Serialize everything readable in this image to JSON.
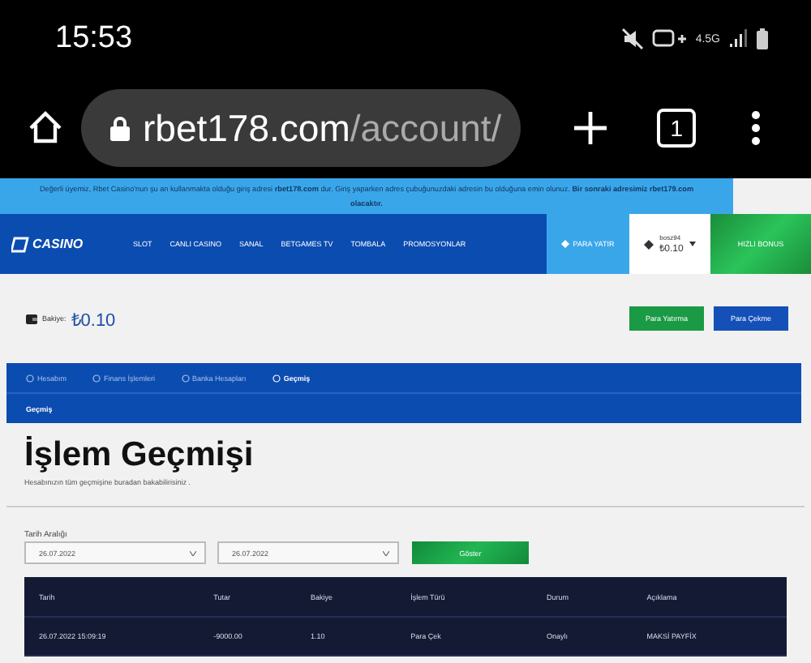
{
  "status_bar": {
    "time": "15:53",
    "network": "4.5G"
  },
  "browser": {
    "url_host": "rbet178.com",
    "url_path": "/account/",
    "tab_count": "1"
  },
  "notice": {
    "text": "Değerli üyemiz, Rbet Casino'nun şu an kullanmakta olduğu giriş adresi **rbet178.com** dur. Giriş yaparken adres çubuğunuzdaki adresin bu olduğuna emin olunuz. **Bir sonraki adresimiz rbet179.com olacaktır.**"
  },
  "nav": {
    "logo": "CASINO",
    "links": [
      "SLOT",
      "CANLI CASINO",
      "SANAL",
      "BETGAMES TV",
      "TOMBALA",
      "PROMOSYONLAR"
    ],
    "deposit": "PARA YATIR",
    "user": {
      "name": "bosz94",
      "balance": "₺0.10"
    },
    "bonus": "HIZLI BONUS"
  },
  "balance": {
    "label": "Bakiye:",
    "value": "₺0.10",
    "buttons": [
      {
        "label": "Para Yatırma",
        "kind": "deposit"
      },
      {
        "label": "Para Çekme",
        "kind": "withdraw"
      }
    ]
  },
  "tabs": [
    {
      "label": "Hesabım",
      "selected": false
    },
    {
      "label": "Finans İşlemleri",
      "selected": false
    },
    {
      "label": "Banka Hesapları",
      "selected": false
    },
    {
      "label": "Geçmiş",
      "selected": true
    }
  ],
  "subtabs": [
    {
      "label": "Geçmiş",
      "selected": true
    }
  ],
  "page": {
    "title": "İşlem Geçmişi",
    "subtitle": "Hesabınızın tüm geçmişine buradan bakabilirisiniz ."
  },
  "filter": {
    "label": "Tarih Aralığı",
    "from": "26.07.2022",
    "to": "26.07.2022",
    "button": "Göster"
  },
  "table": {
    "columns": [
      "Tarih",
      "Tutar",
      "Bakiye",
      "İşlem Türü",
      "Durum",
      "Açıklama"
    ],
    "rows": [
      [
        "26.07.2022 15:09:19",
        "-9000.00",
        "1.10",
        "Para Çek",
        "Onaylı",
        "MAKSİ PAYFİX"
      ]
    ]
  }
}
